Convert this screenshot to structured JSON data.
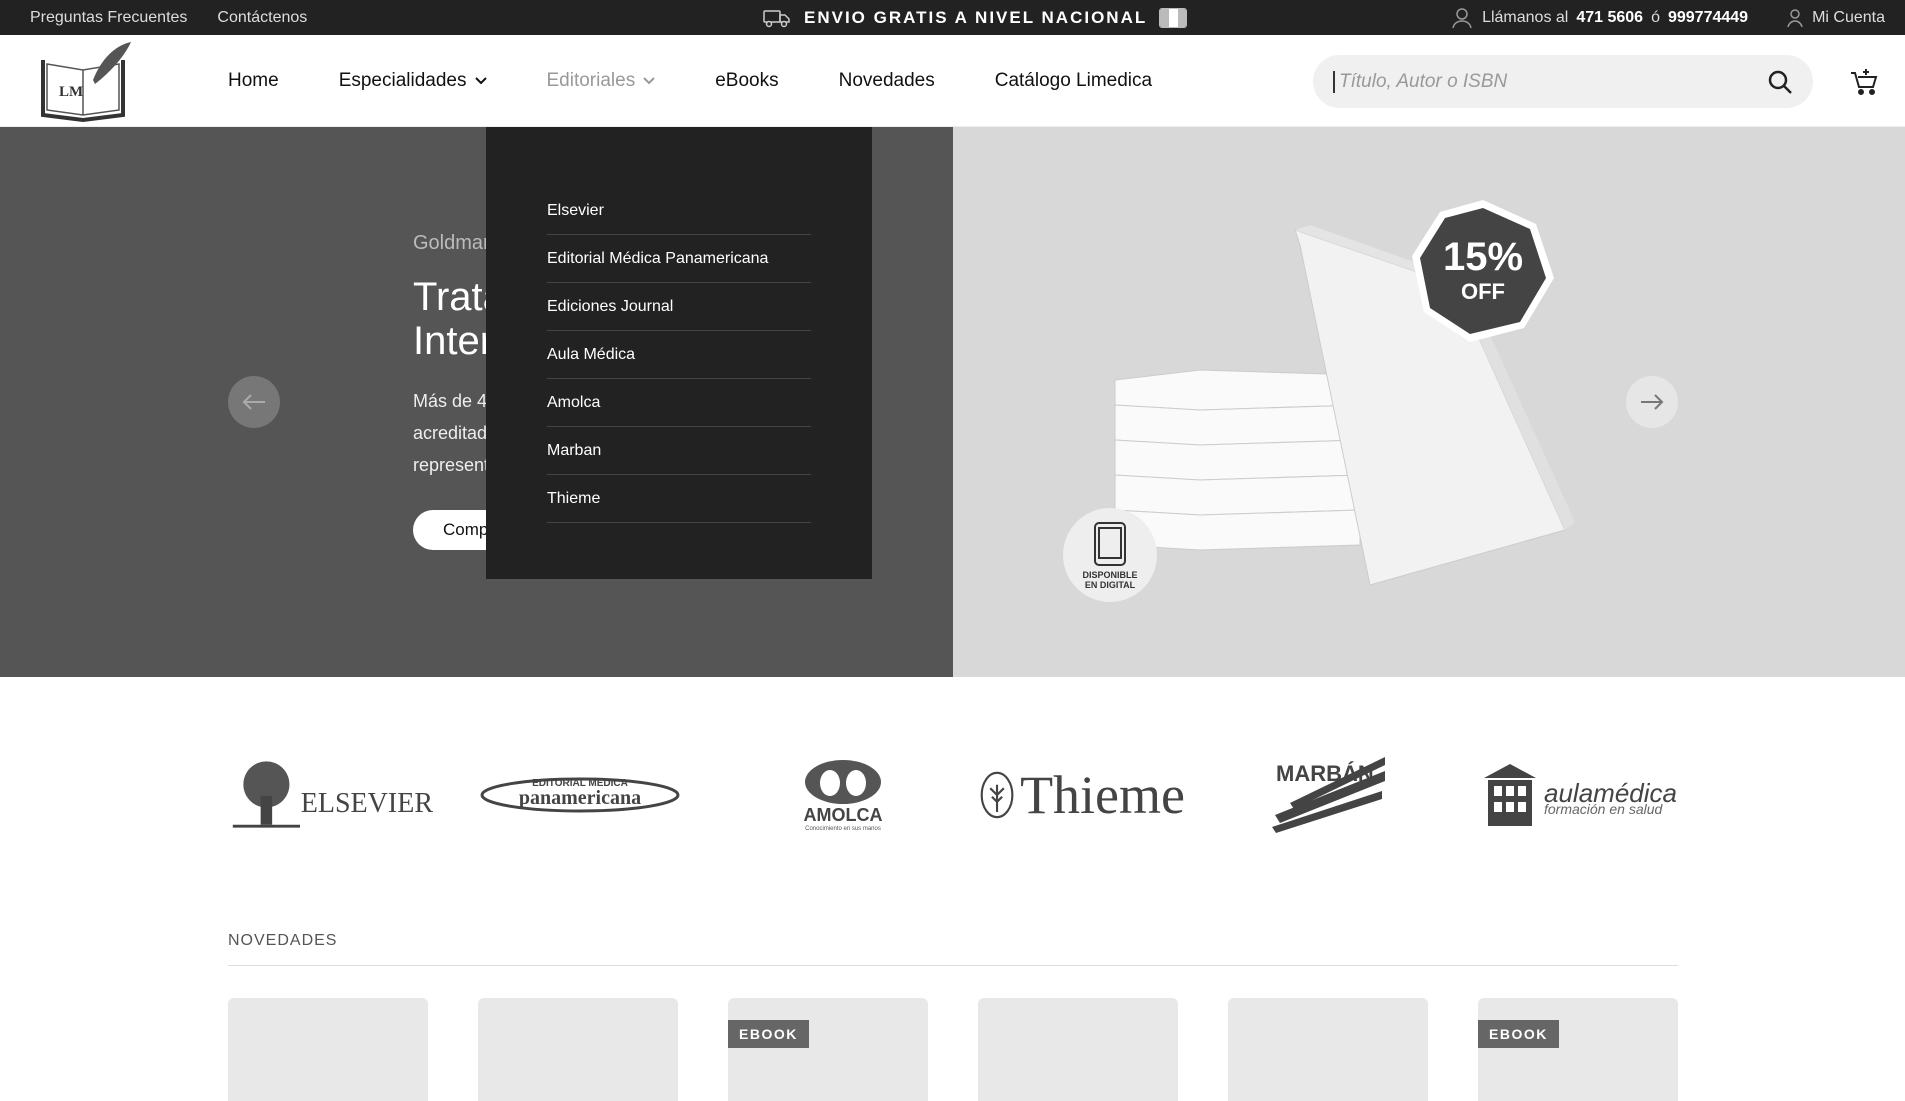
{
  "topbar": {
    "faq": "Preguntas Frecuentes",
    "contact": "Contáctenos",
    "shipping": "ENVIO GRATIS A NIVEL NACIONAL",
    "call_prefix": "Llámanos al",
    "phone1": "471 5606",
    "or": "ó",
    "phone2": "999774449",
    "account": "Mi Cuenta"
  },
  "logo": {
    "text": "LM"
  },
  "nav": {
    "items": [
      {
        "label": "Home"
      },
      {
        "label": "Especialidades"
      },
      {
        "label": "Editoriales"
      },
      {
        "label": "eBooks"
      },
      {
        "label": "Novedades"
      },
      {
        "label": "Catálogo Limedica"
      }
    ]
  },
  "search": {
    "placeholder": "Título, Autor o ISBN"
  },
  "hero": {
    "kicker": "Goldmar",
    "title_line1": "Trata",
    "title_line2": "Inter",
    "desc_line1": "Más de 4",
    "desc_line2": "acreditad",
    "desc_line3": "represent",
    "button": "Comp",
    "badge_pct": "15%",
    "badge_off": "OFF",
    "digital_line1": "DISPONIBLE",
    "digital_line2": "EN DIGITAL"
  },
  "dropdown": {
    "options": [
      {
        "label": "Elsevier"
      },
      {
        "label": "Editorial Médica Panamericana"
      },
      {
        "label": "Ediciones Journal"
      },
      {
        "label": "Aula Médica"
      },
      {
        "label": "Amolca"
      },
      {
        "label": "Marban"
      },
      {
        "label": "Thieme"
      }
    ]
  },
  "brands": {
    "elsevier": "ELSEVIER",
    "panamericana_top": "EDITORIAL MEDICA",
    "panamericana": "panamericana",
    "amolca": "AMOLCA",
    "amolca_sub": "Conocimiento en sus manos",
    "thieme": "Thieme",
    "marban": "MARBÁN",
    "aula": "aulamédica",
    "aula_sub": "formación en salud"
  },
  "novedades": {
    "title": "NOVEDADES",
    "tags": [
      "EBOOK",
      "EBOOK"
    ]
  },
  "colors": {
    "topbar": "#222222",
    "dropdown": "#222222",
    "hero_left": "#555555",
    "hero_right": "#d8d8d8"
  }
}
